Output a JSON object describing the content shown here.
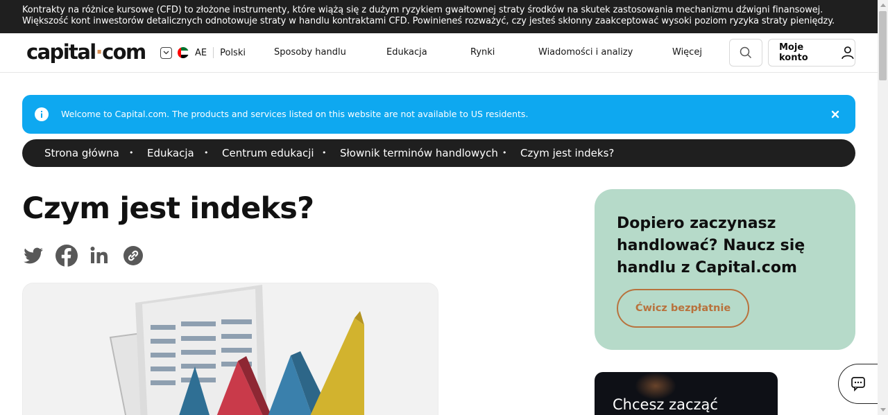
{
  "risk_warning": "Kontrakty na różnice kursowe (CFD) to złożone instrumenty, które wiążą się z dużym ryzykiem gwałtownej straty środków na skutek zastosowania mechanizmu dźwigni finansowej. Większość kont inwestorów detalicznych odnotowuje straty w handlu kontraktami CFD. Powinieneś rozważyć, czy jesteś skłonny zaakceptować wysoki poziom ryzyka straty pieniędzy.",
  "header": {
    "logo_left": "capital",
    "logo_dot": "·",
    "logo_right": "com",
    "region": "AE",
    "language": "Polski",
    "nav": [
      "Sposoby handlu",
      "Edukacja",
      "Rynki",
      "Wiadomości i analizy",
      "Więcej"
    ],
    "account_label": "Moje konto"
  },
  "notice": {
    "message": "Welcome to Capital.com. The products and services listed on this website are not available to US residents."
  },
  "breadcrumb": [
    "Strona główna",
    "Edukacja",
    "Centrum edukacji",
    "Słownik terminów handlowych",
    "Czym jest indeks?"
  ],
  "breadcrumb_separator": "•",
  "article": {
    "title": "Czym jest indeks?"
  },
  "share_icons": [
    "twitter-icon",
    "facebook-icon",
    "linkedin-icon",
    "copy-link-icon"
  ],
  "promo": {
    "title": "Dopiero zaczynasz handlować? Naucz się handlu z Capital.com",
    "button": "Ćwicz bezpłatnie"
  },
  "card2": {
    "title": "Chcesz zacząć"
  },
  "colors": {
    "risk_bar": "#1f1f1f",
    "notice": "#0ea8f0",
    "promo_bg": "#b6dac9",
    "accent": "#b8723d"
  }
}
